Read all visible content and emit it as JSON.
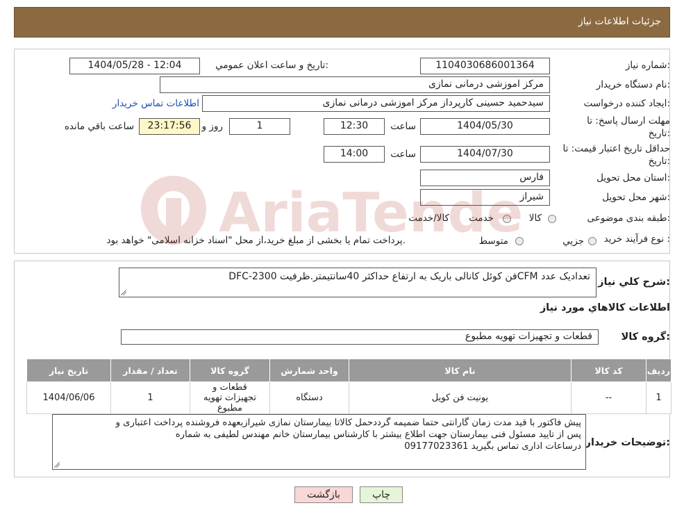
{
  "header": {
    "title": "جزئیات اطلاعات نیاز"
  },
  "info": {
    "need_number_label": "شماره نیاز:",
    "need_number": "1104030686001364",
    "announce_label": "تاریخ و ساعت اعلان عمومي:",
    "announce_value": "1404/05/28 - 12:04",
    "buyer_org_label": "نام دستگاه خریدار:",
    "buyer_org": "مرکز اموزشی درمانی نمازی",
    "creator_label": "ایجاد کننده درخواست:",
    "creator": "سیدحمید حسینی کارپرداز مرکز اموزشی درمانی نمازی",
    "contact_link": "اطلاعات تماس خریدار",
    "deadline_label_1": "مهلت ارسال پاسخ: تا",
    "deadline_label_2": "تاریخ:",
    "deadline_date": "1404/05/30",
    "time_label": "ساعت",
    "deadline_time": "12:30",
    "days_value": "1",
    "days_label": "روز و",
    "remaining_time": "23:17:56",
    "remaining_label": "ساعت باقي مانده",
    "validity_label_1": "حداقل تاریخ اعتبار قیمت: تا",
    "validity_label_2": "تاریخ:",
    "validity_date": "1404/07/30",
    "validity_time_label": "ساعت",
    "validity_time": "14:00",
    "province_label": "استان محل تحویل:",
    "province": "فارس",
    "city_label": "شهر محل تحویل:",
    "city": "شیراز",
    "category_label": "طبقه بندی موضوعی:",
    "category_options": [
      "کالا",
      "خدمت",
      "کالا/خدمت"
    ],
    "process_label": "نوع فرآیند خرید :",
    "process_options": [
      "جزيي",
      "متوسط"
    ],
    "process_note": "پرداخت تمام یا بخشی از مبلغ خرید،از محل \"اسناد خزانه اسلامی\" خواهد بود."
  },
  "watermark": {
    "text": "AriaTender.neT"
  },
  "needs": {
    "summary_label": "شرح كلي نياز:",
    "summary": "DFC-فن کوئل کانالی باریک به ارتفاع حداکثر 40سانتیمتر.ظرفیت 2300CFM تعدادیک عدد",
    "goods_info_title": "اطلاعات کالاهاي مورد نياز",
    "goods_group_label": "گروه کالا:",
    "goods_group": "قطعات و تجهیزات تهویه مطبوع",
    "table": {
      "headers": [
        "رديف",
        "کد کالا",
        "نام کالا",
        "واحد شمارش",
        "گروه کالا",
        "تعداد / مقدار",
        "تاریخ نیاز"
      ],
      "rows": [
        [
          "1",
          "--",
          "یونیت فن کویل",
          "دستگاه",
          "قطعات و تجهیزات تهویه مطبوع",
          "1",
          "1404/06/06"
        ]
      ]
    },
    "buyer_notes_label": "توضیحات خریدار:",
    "buyer_notes_line1": "پیش فاکتور با قید مدت زمان  گارانتی حتما ضمیمه گرددحمل کالاتا بیمارستان نمازی شیرازبعهده فروشنده پرداخت اعتباری و",
    "buyer_notes_line2": "پس از تایید مسئول فنی بیمارستان جهت اطلاع بیشتر با کارشناس بیمارستان خانم مهندس لطیفی به شماره",
    "buyer_notes_line3": "09177023361 درساعات اداری تماس بگیرید"
  },
  "buttons": {
    "print": "چاپ",
    "back": "بازگشت"
  },
  "colors": {
    "header_bg": "#8b6a41",
    "table_header_bg": "#9a9a9a",
    "back_button_bg": "#f8d7d7",
    "print_button_bg": "#e6f4d8"
  }
}
